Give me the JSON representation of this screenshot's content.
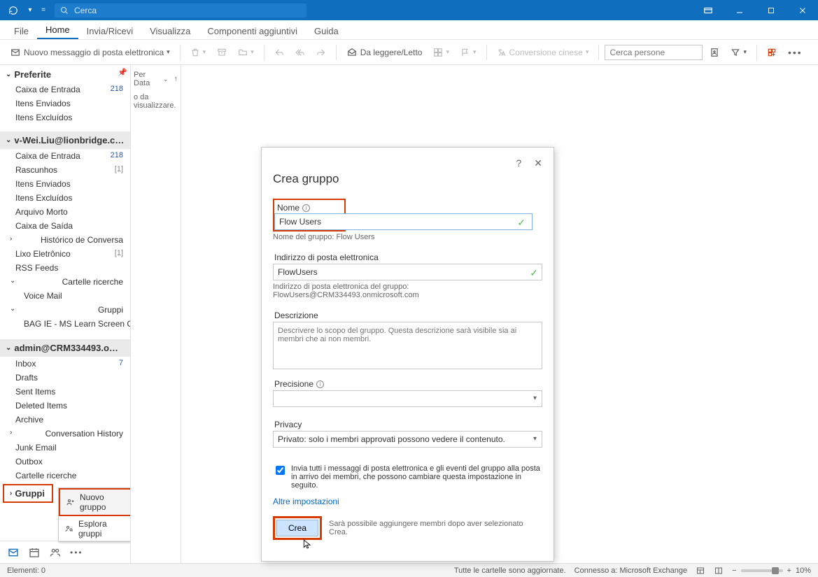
{
  "titlebar": {
    "search_placeholder": "Cerca"
  },
  "tabs": {
    "file": "File",
    "home": "Home",
    "send_receive": "Invia/Ricevi",
    "view": "Visualizza",
    "addins": "Componenti aggiuntivi",
    "help": "Guida"
  },
  "ribbon": {
    "new_email": "Nuovo messaggio di posta elettronica",
    "read_unread": "Da leggere/Letto",
    "chinese_conv": "Conversione cinese",
    "search_people_ph": "Cerca persone"
  },
  "midcol": {
    "sort_label": "Per Data",
    "empty_hint": "o da visualizzare."
  },
  "nav": {
    "favorites": "Preferite",
    "account1": "v-Wei.Liu@lionbridge.com",
    "account2": "admin@CRM334493.o…",
    "folders_fav": [
      {
        "name": "Caixa de Entrada",
        "count": "218"
      },
      {
        "name": "Itens Enviados",
        "count": ""
      },
      {
        "name": "Itens Excluídos",
        "count": ""
      }
    ],
    "folders_a1": [
      {
        "name": "Caixa de Entrada",
        "count": "218"
      },
      {
        "name": "Rascunhos",
        "count": "[1]"
      },
      {
        "name": "Itens Enviados",
        "count": ""
      },
      {
        "name": "Itens Excluídos",
        "count": ""
      },
      {
        "name": "Arquivo Morto",
        "count": ""
      },
      {
        "name": "Caixa de Saída",
        "count": ""
      }
    ],
    "hist_conversa": "Histórico de Conversa",
    "lixo": {
      "name": "Lixo Eletrônico",
      "count": "[1]"
    },
    "rss": "RSS Feeds",
    "search_folders": "Cartelle ricerche",
    "voicemail": "Voice Mail",
    "gruppi": "Gruppi",
    "gruppi_item": "BAG IE - MS Learn Screen Cap…",
    "folders_a2": [
      {
        "name": "Inbox",
        "count": "7"
      },
      {
        "name": "Drafts",
        "count": ""
      },
      {
        "name": "Sent Items",
        "count": ""
      },
      {
        "name": "Deleted Items",
        "count": ""
      },
      {
        "name": "Archive",
        "count": ""
      }
    ],
    "conv_history": "Conversation History",
    "junk": "Junk Email",
    "outbox": "Outbox",
    "search_folders2": "Cartelle ricerche",
    "gruppi2": "Gruppi"
  },
  "context": {
    "new_group": "Nuovo gruppo",
    "explore": "Esplora gruppi"
  },
  "dialog": {
    "title": "Crea gruppo",
    "name_label": "Nome",
    "name_value": "Flow Users",
    "name_hint": "Nome del gruppo: Flow Users",
    "email_label": "Indirizzo di posta elettronica",
    "email_value": "FlowUsers",
    "email_hint": "Indirizzo di posta elettronica del gruppo: FlowUsers@CRM334493.onmicrosoft.com",
    "desc_label": "Descrizione",
    "desc_ph": "Descrivere lo scopo del gruppo. Questa descrizione sarà visibile sia ai membri che ai non membri.",
    "precision_label": "Precisione",
    "privacy_label": "Privacy",
    "privacy_value": "Privato: solo i membri approvati possono vedere il contenuto.",
    "checkbox_label": "Invia tutti i messaggi di posta elettronica e gli eventi del gruppo alla posta in arrivo dei membri, che possono cambiare questa impostazione in seguito.",
    "more_link": "Altre impostazioni",
    "create_btn": "Crea",
    "create_hint": "Sarà possibile aggiungere membri dopo aver selezionato Crea."
  },
  "statusbar": {
    "items": "Elementi: 0",
    "sync": "Tutte le cartelle sono aggiornate.",
    "conn": "Connesso a: Microsoft Exchange",
    "zoom": "10%"
  }
}
